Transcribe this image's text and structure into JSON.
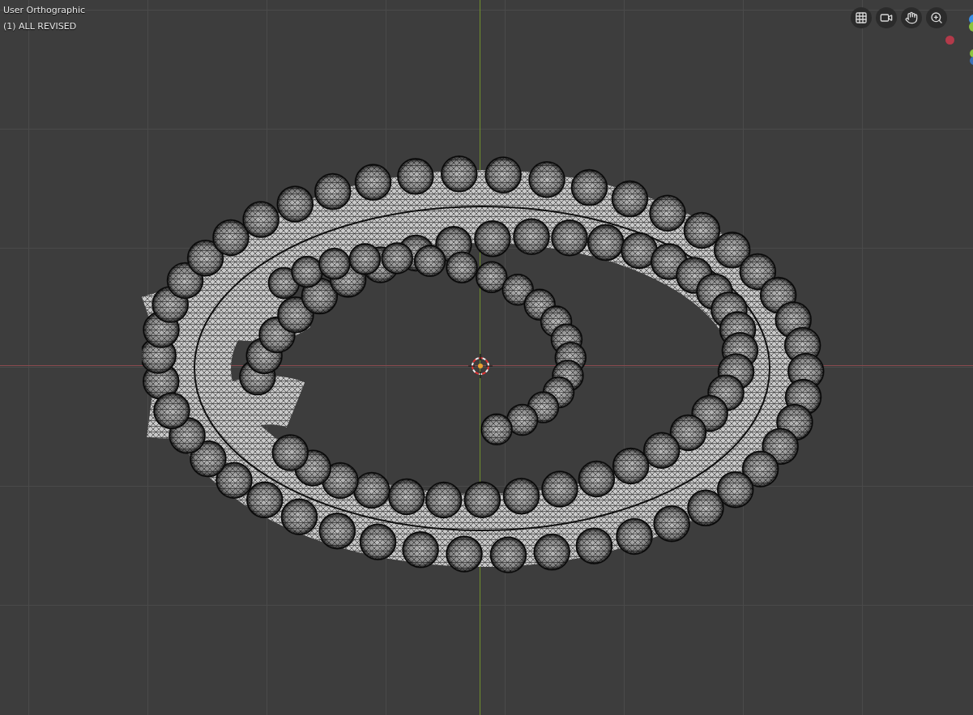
{
  "viewport": {
    "view_name": "User Orthographic",
    "object_info": "(1) ALL REVISED"
  }
}
